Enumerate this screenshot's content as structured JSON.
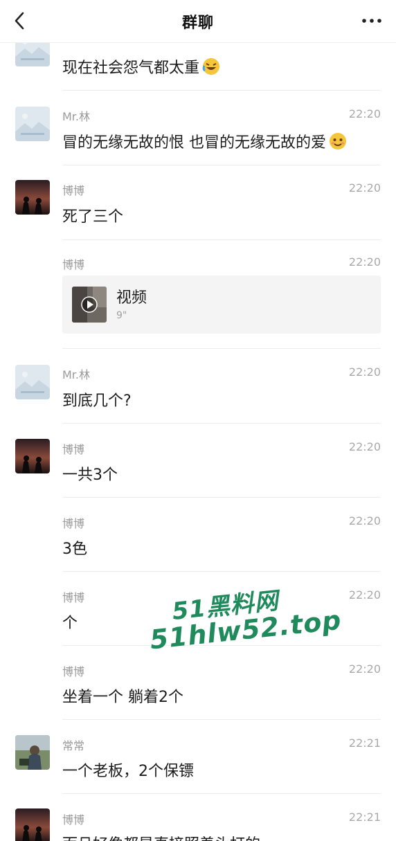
{
  "header": {
    "title": "群聊",
    "back_icon": "chevron-left-icon",
    "more_icon": "ellipsis-icon"
  },
  "messages": [
    {
      "sender": "",
      "time": "",
      "text": "现在社会怨气都太重",
      "emoji": "laughing-crying-emoji",
      "avatar": "landscape-placeholder"
    },
    {
      "sender": "Mr.林",
      "time": "22:20",
      "text": "冒的无缘无故的恨 也冒的无缘无故的爱",
      "emoji": "flushed-smile-emoji",
      "avatar": "landscape-placeholder"
    },
    {
      "sender": "博博",
      "time": "22:20",
      "text": "死了三个",
      "avatar": "sunset-couple"
    },
    {
      "sender": "博博",
      "time": "22:20",
      "video": {
        "title": "视频",
        "duration": "9\""
      }
    },
    {
      "sender": "Mr.林",
      "time": "22:20",
      "text": "到底几个?",
      "avatar": "landscape-placeholder"
    },
    {
      "sender": "博博",
      "time": "22:20",
      "text": "一共3个",
      "avatar": "sunset-couple"
    },
    {
      "sender": "博博",
      "time": "22:20",
      "text": "3色"
    },
    {
      "sender": "博博",
      "time": "22:20",
      "text": "个"
    },
    {
      "sender": "博博",
      "time": "22:20",
      "text": "坐着一个 躺着2个"
    },
    {
      "sender": "常常",
      "time": "22:21",
      "text": "一个老板，2个保镖",
      "avatar": "photo-avatar"
    },
    {
      "sender": "博博",
      "time": "22:21",
      "text": "而且好像都是直接照着头打的",
      "avatar": "sunset-couple"
    }
  ],
  "watermark": {
    "line1": "51黑料网",
    "line2": "51hlw52.top",
    "color": "#1f8a5b"
  }
}
